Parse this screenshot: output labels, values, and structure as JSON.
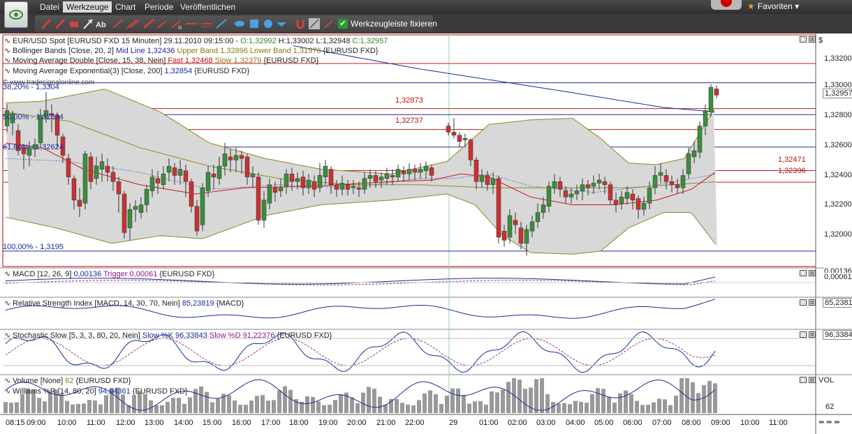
{
  "menu": {
    "items": [
      {
        "label": "Datei"
      },
      {
        "label": "Werkzeuge"
      },
      {
        "label": "Chart"
      },
      {
        "label": "Periode"
      },
      {
        "label": "Veröffentlichen"
      }
    ]
  },
  "toolbar": {
    "fix_label": "Werkzeugleiste fixieren",
    "text_tool_label": "Ab",
    "tool_icons": [
      "pen-red-icon",
      "pen-red-icon",
      "pen-red-icon",
      "eraser-icon",
      "text-tool-icon",
      "arrow-tool-icon",
      "line-tool-icon",
      "line-tool-icon",
      "line-tool-icon",
      "pen-tool-icon",
      "ellipse-tool-icon",
      "rectangle-tool-icon",
      "circle-tool-icon",
      "triangle-tool-icon",
      "magnet-icon",
      "chart-style-icon",
      "pencil-icon",
      "checkbox-icon"
    ]
  },
  "favorites": {
    "label": "Favoriten"
  },
  "main_panel": {
    "legend": [
      {
        "parts": [
          {
            "t": "EUR/USD Spot [EURUSD FXD  15 Minuten] 29.11.2010 09:15:00 - ",
            "c": ""
          },
          {
            "t": "O:1,32992",
            "c": "c-green"
          },
          {
            "t": " H:1,33002 L:1,32948 ",
            "c": ""
          },
          {
            "t": "C:1,32957",
            "c": "c-green"
          }
        ]
      },
      {
        "parts": [
          {
            "t": "Bollinger Bands [Close, 20, 2] ",
            "c": ""
          },
          {
            "t": "Mid Line 1,32436",
            "c": "c-blue"
          },
          {
            "t": " ",
            "c": ""
          },
          {
            "t": "Upper Band 1,32896",
            "c": "c-olive"
          },
          {
            "t": " ",
            "c": ""
          },
          {
            "t": "Lower Band 1,31976",
            "c": "c-olive"
          },
          {
            "t": " {EURUSD FXD}",
            "c": ""
          }
        ]
      },
      {
        "parts": [
          {
            "t": "Moving Average Double [Close, 15, 38, Nein] ",
            "c": ""
          },
          {
            "t": "Fast 1,32468",
            "c": "c-red"
          },
          {
            "t": " ",
            "c": ""
          },
          {
            "t": "Slow 1,32379",
            "c": "c-olive"
          },
          {
            "t": " {EURUSD FXD}",
            "c": ""
          }
        ]
      },
      {
        "parts": [
          {
            "t": "Moving Average Exponential(3) [Close, 200] ",
            "c": ""
          },
          {
            "t": "1,32854",
            "c": "c-blue"
          },
          {
            "t": " {EURUSD FXD}",
            "c": ""
          }
        ]
      }
    ],
    "watermark": "© www.tradesignalonline.com",
    "fib_levels": [
      "38,20% - 1,3304",
      "50,00% - 1,32834",
      "61,80% - 1,32624",
      "100,00% - 1,3195"
    ],
    "price_levels": [
      "1,32873",
      "1,32737",
      "1,32471",
      "1,32396"
    ],
    "y_axis_unit": "$",
    "y_axis": [
      "1,33200",
      "1,33000",
      "1,32800",
      "1,32600",
      "1,32400",
      "1,32200",
      "1,32000"
    ],
    "last_price": "1,32957"
  },
  "subpanels": [
    {
      "legend": [
        {
          "t": "MACD [12, 26, 9] ",
          "c": ""
        },
        {
          "t": "0,00136",
          "c": "c-blue"
        },
        {
          "t": " ",
          "c": ""
        },
        {
          "t": "Trigger 0,00061",
          "c": "c-purple"
        },
        {
          "t": " {EURUSD FXD}",
          "c": ""
        }
      ],
      "values": [
        "0,00136",
        "0,00061"
      ]
    },
    {
      "legend": [
        {
          "t": "Relative Strength Index [MACD, 14, 30, 70, Nein] ",
          "c": ""
        },
        {
          "t": "85,23819",
          "c": "c-blue"
        },
        {
          "t": " {MACD}",
          "c": ""
        }
      ],
      "values": [
        "85,2381"
      ]
    },
    {
      "legend": [
        {
          "t": "Stochastic Slow [5, 3, 3, 80, 20, Nein] ",
          "c": ""
        },
        {
          "t": "Slow %K 96,33843",
          "c": "c-blue"
        },
        {
          "t": " ",
          "c": ""
        },
        {
          "t": "Slow %D 91,22376",
          "c": "c-purple"
        },
        {
          "t": " {EURUSD FXD}",
          "c": ""
        }
      ],
      "values": [
        "96,3384"
      ]
    },
    {
      "legend": [
        {
          "t": "Volume [None] ",
          "c": ""
        },
        {
          "t": "62",
          "c": "c-olive"
        },
        {
          "t": " {EURUSD FXD}",
          "c": ""
        }
      ],
      "legend2": [
        {
          "t": "Williams %R [14, 80, 20] ",
          "c": ""
        },
        {
          "t": "94,94361",
          "c": "c-blue"
        },
        {
          "t": " {EURUSD FXD}",
          "c": ""
        }
      ],
      "values": [
        "VOL",
        "62"
      ]
    }
  ],
  "time_axis": [
    "08:15",
    "09:00",
    "10:00",
    "11:00",
    "12:00",
    "13:00",
    "14:00",
    "15:00",
    "16:00",
    "17:00",
    "18:00",
    "19:00",
    "20:00",
    "21:00",
    "22:00",
    "29",
    "01:00",
    "02:00",
    "03:00",
    "04:00",
    "05:00",
    "06:00",
    "07:00",
    "08:00",
    "09:00",
    "10:00",
    "11:00"
  ],
  "colors": {
    "bull": "#3c8c3c",
    "bear": "#c83232",
    "blue_line": "#1a2a9a",
    "red_line": "#c81818",
    "olive": "#8a8a20",
    "band_fill": "#d8d8d8",
    "frame": "#c00000"
  }
}
